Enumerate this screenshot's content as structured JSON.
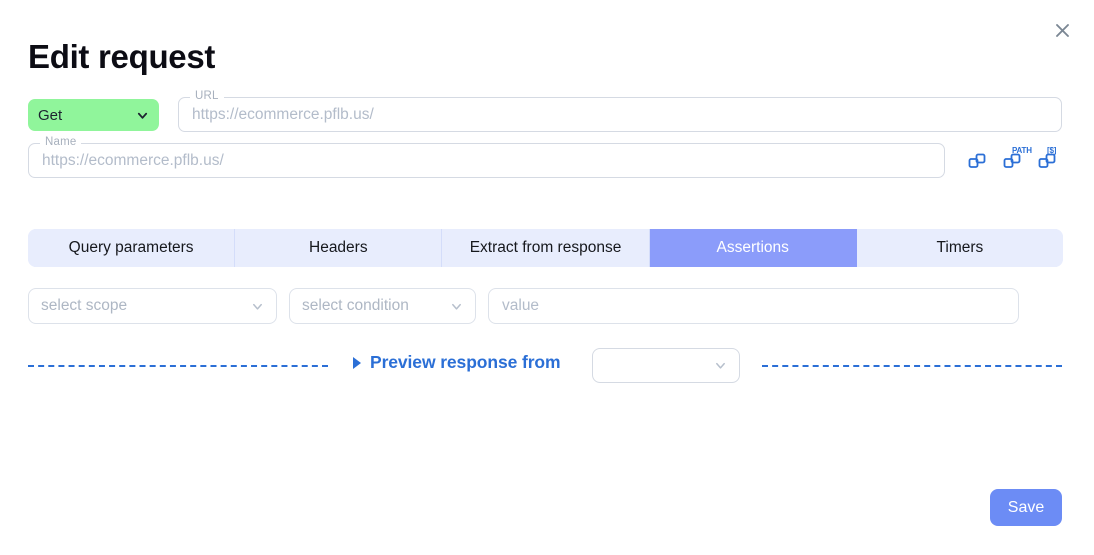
{
  "dialog": {
    "title": "Edit request",
    "close_icon": "close-icon"
  },
  "request_bar": {
    "method": {
      "value": "Get",
      "icon": "chevron-down-icon"
    },
    "url": {
      "label": "URL",
      "value": "",
      "placeholder": "https://ecommerce.pflb.us/"
    },
    "name": {
      "label": "Name",
      "value": "",
      "placeholder": "https://ecommerce.pflb.us/"
    },
    "actions": [
      {
        "name": "copy-url-icon",
        "sup": ""
      },
      {
        "name": "copy-path-icon",
        "sup": "PATH"
      },
      {
        "name": "copy-variable-icon",
        "sup": "[$]"
      }
    ]
  },
  "tabs": [
    {
      "label": "Query parameters",
      "active": false
    },
    {
      "label": "Headers",
      "active": false
    },
    {
      "label": "Extract from response",
      "active": false
    },
    {
      "label": "Assertions",
      "active": true
    },
    {
      "label": "Timers",
      "active": false
    }
  ],
  "assertion_row": {
    "scope": {
      "placeholder": "select scope",
      "value": ""
    },
    "condition": {
      "placeholder": "select condition",
      "value": ""
    },
    "value": {
      "placeholder": "value",
      "value": ""
    }
  },
  "preview": {
    "link_label": "Preview response from",
    "arrow_icon": "play-triangle-icon",
    "source": {
      "value": "",
      "placeholder": ""
    }
  },
  "footer": {
    "save_label": "Save"
  },
  "colors": {
    "method_green": "#90f59b",
    "tab_active": "#8b9cfa",
    "tab_bg": "#e8edfd",
    "accent_blue": "#2b6fd6",
    "save_blue": "#6c8cf5"
  }
}
